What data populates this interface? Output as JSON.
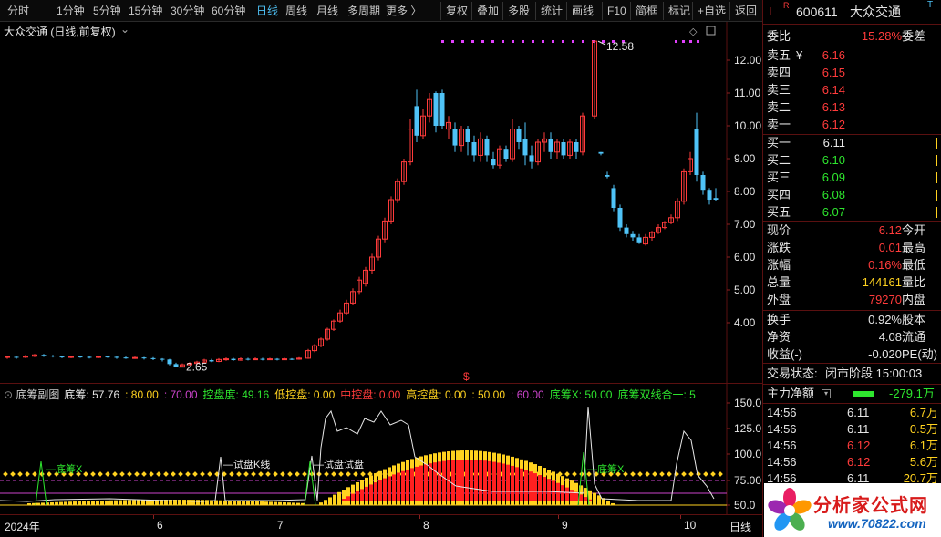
{
  "toolbar": {
    "periods": [
      "分时",
      "1分钟",
      "5分钟",
      "15分钟",
      "30分钟",
      "60分钟",
      "日线",
      "周线",
      "月线",
      "多周期",
      "更多 〉"
    ],
    "active_period": "日线",
    "tools": [
      "复权",
      "叠加",
      "多股",
      "统计",
      "画线",
      "F10",
      "简框",
      "标记",
      "+自选",
      "返回"
    ]
  },
  "main": {
    "title": "大众交通 (日线,前复权)",
    "price_axis": [
      "12.00",
      "11.00",
      "10.00",
      "9.00",
      "8.00",
      "7.00",
      "6.00",
      "5.00",
      "4.00"
    ],
    "high_label": "12.58",
    "low_label": "2.65",
    "marker": "$"
  },
  "sub": {
    "name": "底筹副图",
    "indicators": [
      {
        "label": "底筹:",
        "value": "57.76",
        "color": "#e6e6e6"
      },
      {
        "label": ":",
        "value": "80.00",
        "color": "#ffd21f"
      },
      {
        "label": ":",
        "value": "70.00",
        "color": "#cc44cc"
      },
      {
        "label": "控盘度:",
        "value": "49.16",
        "color": "#2ee62e"
      },
      {
        "label": "低控盘:",
        "value": "0.00",
        "color": "#ffd21f"
      },
      {
        "label": "中控盘:",
        "value": "0.00",
        "color": "#ff3b3b"
      },
      {
        "label": "高控盘:",
        "value": "0.00",
        "color": "#ffd21f"
      },
      {
        "label": ":",
        "value": "50.00",
        "color": "#ffd21f"
      },
      {
        "label": ":",
        "value": "60.00",
        "color": "#cc44cc"
      },
      {
        "label": "底筹X:",
        "value": "50.00",
        "color": "#2ee62e"
      },
      {
        "label": "底筹双线合一:",
        "value": "5",
        "color": "#2ee62e"
      }
    ],
    "axis": [
      "150.0",
      "125.0",
      "100.0",
      "75.00",
      "50.0"
    ],
    "annotations": [
      "底筹X",
      "试盘K线",
      "试盘试盘",
      "底筹X"
    ]
  },
  "dates": [
    "2024年",
    "6",
    "7",
    "8",
    "9",
    "10",
    "日线"
  ],
  "quote": {
    "flag": "L",
    "code": "600611",
    "name": "大众交通",
    "weibi_label": "委比",
    "weibi": "15.28%",
    "weicha_label": "委差",
    "asks": [
      {
        "label": "卖五",
        "extra": "¥",
        "price": "6.16"
      },
      {
        "label": "卖四",
        "price": "6.15"
      },
      {
        "label": "卖三",
        "price": "6.14"
      },
      {
        "label": "卖二",
        "price": "6.13"
      },
      {
        "label": "卖一",
        "price": "6.12"
      }
    ],
    "bids": [
      {
        "label": "买一",
        "price": "6.11"
      },
      {
        "label": "买二",
        "price": "6.10"
      },
      {
        "label": "买三",
        "price": "6.09"
      },
      {
        "label": "买四",
        "price": "6.08"
      },
      {
        "label": "买五",
        "price": "6.07"
      }
    ],
    "stats": [
      {
        "l": "现价",
        "v": "6.12",
        "r": "今开",
        "c": "#ff3b3b"
      },
      {
        "l": "涨跌",
        "v": "0.01",
        "r": "最高",
        "c": "#ff3b3b"
      },
      {
        "l": "涨幅",
        "v": "0.16%",
        "r": "最低",
        "c": "#ff3b3b"
      },
      {
        "l": "总量",
        "v": "144161",
        "r": "量比",
        "c": "#ffd21f"
      },
      {
        "l": "外盘",
        "v": "79270",
        "r": "内盘",
        "c": "#ff3b3b"
      },
      {
        "l": "换手",
        "v": "0.92%",
        "r": "股本",
        "c": "#e6e6e6"
      },
      {
        "l": "净资",
        "v": "4.08",
        "r": "流通",
        "c": "#e6e6e6"
      },
      {
        "l": "收益(-)",
        "v": "-0.020",
        "r": "PE(动)",
        "c": "#e6e6e6"
      }
    ],
    "status_label": "交易状态:",
    "status": "闭市阶段 15:00:03",
    "flow_label": "主力净额",
    "flow_value": "-279.1万",
    "ticks": [
      {
        "t": "14:56",
        "p": "6.11",
        "v": "6.7万",
        "pc": "#e6e6e6",
        "vc": "#ffd21f"
      },
      {
        "t": "14:56",
        "p": "6.11",
        "v": "0.5万",
        "pc": "#e6e6e6",
        "vc": "#ffd21f"
      },
      {
        "t": "14:56",
        "p": "6.12",
        "v": "6.1万",
        "pc": "#ff3b3b",
        "vc": "#ffd21f"
      },
      {
        "t": "14:56",
        "p": "6.12",
        "v": "5.6万",
        "pc": "#ff3b3b",
        "vc": "#ffd21f"
      },
      {
        "t": "14:56",
        "p": "6.11",
        "v": "20.7万",
        "pc": "#e6e6e6",
        "vc": "#ffd21f"
      }
    ]
  },
  "logo": {
    "text": "分析家公式网",
    "url": "www.70822.com"
  },
  "colors": {
    "up": "#ff3b3b",
    "down": "#4fc3f7",
    "grid": "#5a1010",
    "yellow": "#ffd21f"
  }
}
